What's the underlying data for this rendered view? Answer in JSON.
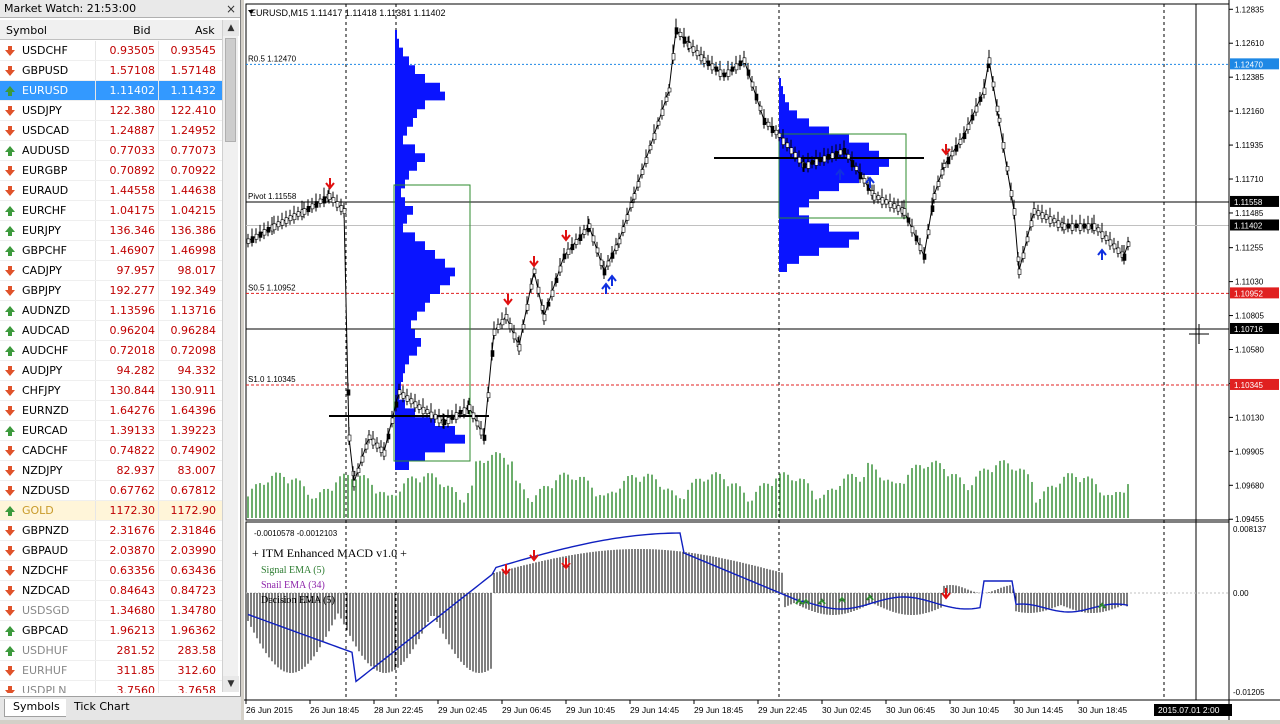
{
  "market_watch": {
    "title": "Market Watch: 21:53:00",
    "close_glyph": "×",
    "headers": {
      "symbol": "Symbol",
      "bid": "Bid",
      "ask": "Ask"
    },
    "rows": [
      {
        "symbol": "USDCHF",
        "bid": "0.93505",
        "ask": "0.93545",
        "dir": "down"
      },
      {
        "symbol": "GBPUSD",
        "bid": "1.57108",
        "ask": "1.57148",
        "dir": "down"
      },
      {
        "symbol": "EURUSD",
        "bid": "1.11402",
        "ask": "1.11432",
        "dir": "up",
        "state": "selected"
      },
      {
        "symbol": "USDJPY",
        "bid": "122.380",
        "ask": "122.410",
        "dir": "down"
      },
      {
        "symbol": "USDCAD",
        "bid": "1.24887",
        "ask": "1.24952",
        "dir": "down"
      },
      {
        "symbol": "AUDUSD",
        "bid": "0.77033",
        "ask": "0.77073",
        "dir": "up"
      },
      {
        "symbol": "EURGBP",
        "bid": "0.70892",
        "ask": "0.70922",
        "dir": "down"
      },
      {
        "symbol": "EURAUD",
        "bid": "1.44558",
        "ask": "1.44638",
        "dir": "down"
      },
      {
        "symbol": "EURCHF",
        "bid": "1.04175",
        "ask": "1.04215",
        "dir": "up"
      },
      {
        "symbol": "EURJPY",
        "bid": "136.346",
        "ask": "136.386",
        "dir": "up"
      },
      {
        "symbol": "GBPCHF",
        "bid": "1.46907",
        "ask": "1.46998",
        "dir": "up"
      },
      {
        "symbol": "CADJPY",
        "bid": "97.957",
        "ask": "98.017",
        "dir": "down"
      },
      {
        "symbol": "GBPJPY",
        "bid": "192.277",
        "ask": "192.349",
        "dir": "down"
      },
      {
        "symbol": "AUDNZD",
        "bid": "1.13596",
        "ask": "1.13716",
        "dir": "up"
      },
      {
        "symbol": "AUDCAD",
        "bid": "0.96204",
        "ask": "0.96284",
        "dir": "up"
      },
      {
        "symbol": "AUDCHF",
        "bid": "0.72018",
        "ask": "0.72098",
        "dir": "up"
      },
      {
        "symbol": "AUDJPY",
        "bid": "94.282",
        "ask": "94.332",
        "dir": "down"
      },
      {
        "symbol": "CHFJPY",
        "bid": "130.844",
        "ask": "130.911",
        "dir": "down"
      },
      {
        "symbol": "EURNZD",
        "bid": "1.64276",
        "ask": "1.64396",
        "dir": "down"
      },
      {
        "symbol": "EURCAD",
        "bid": "1.39133",
        "ask": "1.39223",
        "dir": "up"
      },
      {
        "symbol": "CADCHF",
        "bid": "0.74822",
        "ask": "0.74902",
        "dir": "down"
      },
      {
        "symbol": "NZDJPY",
        "bid": "82.937",
        "ask": "83.007",
        "dir": "down"
      },
      {
        "symbol": "NZDUSD",
        "bid": "0.67762",
        "ask": "0.67812",
        "dir": "down"
      },
      {
        "symbol": "GOLD",
        "bid": "1172.30",
        "ask": "1172.90",
        "dir": "up",
        "state": "gold"
      },
      {
        "symbol": "GBPNZD",
        "bid": "2.31676",
        "ask": "2.31846",
        "dir": "down"
      },
      {
        "symbol": "GBPAUD",
        "bid": "2.03870",
        "ask": "2.03990",
        "dir": "down"
      },
      {
        "symbol": "NZDCHF",
        "bid": "0.63356",
        "ask": "0.63436",
        "dir": "down"
      },
      {
        "symbol": "NZDCAD",
        "bid": "0.84643",
        "ask": "0.84723",
        "dir": "down"
      },
      {
        "symbol": "USDSGD",
        "bid": "1.34680",
        "ask": "1.34780",
        "dir": "down",
        "state": "gray"
      },
      {
        "symbol": "GBPCAD",
        "bid": "1.96213",
        "ask": "1.96362",
        "dir": "up"
      },
      {
        "symbol": "USDHUF",
        "bid": "281.52",
        "ask": "283.58",
        "dir": "up",
        "state": "gray"
      },
      {
        "symbol": "EURHUF",
        "bid": "311.85",
        "ask": "312.60",
        "dir": "down",
        "state": "gray"
      },
      {
        "symbol": "USDPLN",
        "bid": "3.7560",
        "ask": "3.7658",
        "dir": "down",
        "state": "gray"
      }
    ],
    "tabs": [
      "Symbols",
      "Tick Chart"
    ]
  },
  "chart": {
    "header": "EURUSD,M15  1.11417 1.11418 1.11381 1.11402",
    "level_labels": [
      {
        "text": "R0.5 1.12470",
        "price": 1.1247,
        "style": "dashed-blue"
      },
      {
        "text": "Pivot 1.11558",
        "price": 1.11558,
        "style": "solid-black"
      },
      {
        "text": "S0.5 1.10952",
        "price": 1.10952,
        "style": "dashed-red"
      },
      {
        "text": "S1.0 1.10345",
        "price": 1.10345,
        "style": "dashed-red"
      }
    ],
    "extra_line_price": 1.10716,
    "price_axis": [
      "1.12835",
      "1.12610",
      "1.12385",
      "1.12160",
      "1.11935",
      "1.11710",
      "1.11485",
      "1.11255",
      "1.11030",
      "1.10805",
      "1.10580",
      "1.10355",
      "1.10130",
      "1.09905",
      "1.09680",
      "1.09455"
    ],
    "price_axis_range": [
      1.0945,
      1.1287
    ],
    "price_tags": [
      {
        "text": "1.12470",
        "price": 1.1247,
        "bg": "#1e88e5"
      },
      {
        "text": "1.11558",
        "price": 1.11558,
        "bg": "#000000"
      },
      {
        "text": "1.11402",
        "price": 1.11402,
        "bg": "#000000"
      },
      {
        "text": "1.10952",
        "price": 1.10952,
        "bg": "#e02020"
      },
      {
        "text": "1.10716",
        "price": 1.10716,
        "bg": "#000000"
      },
      {
        "text": "1.10345",
        "price": 1.10345,
        "bg": "#e02020"
      }
    ],
    "indicator": {
      "values_label": "-0.0010578 -0.0012103",
      "title": "+ ITM Enhanced MACD v1.0 +",
      "signal": "Signal EMA (5)",
      "snail": "Snail EMA (34)",
      "decision": "Decision EMA (5)",
      "axis": [
        "0.008137",
        "0.00",
        "-0.01205"
      ],
      "signal_color": "#2e7d32",
      "snail_color": "#8e24aa"
    },
    "time_axis": [
      "26 Jun 2015",
      "26 Jun 18:45",
      "28 Jun 22:45",
      "29 Jun 02:45",
      "29 Jun 06:45",
      "29 Jun 10:45",
      "29 Jun 14:45",
      "29 Jun 18:45",
      "29 Jun 22:45",
      "30 Jun 02:45",
      "30 Jun 06:45",
      "30 Jun 10:45",
      "30 Jun 14:45",
      "30 Jun 18:45"
    ],
    "time_cursor": "2015.07.01 2:00",
    "colors": {
      "profile": "#0a14ff",
      "volume": "#2e8b2e",
      "arrow_down": "#e01010",
      "arrow_up": "#1030e0"
    }
  }
}
